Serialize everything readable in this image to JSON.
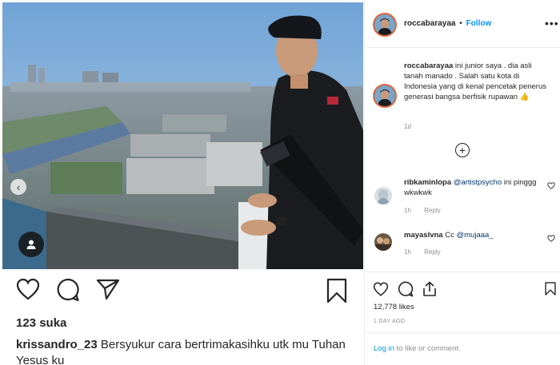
{
  "post": {
    "likes_count_text": "123 suka",
    "caption_user": "krissandro_23",
    "caption_text": "Bersyukur cara bertrimakasihku utk mu Tuhan Yesus ku"
  },
  "panel": {
    "username": "roccabarayaa",
    "separator": "•",
    "follow_label": "Follow",
    "more_label": "•••",
    "owner_caption": {
      "user": "roccabarayaa",
      "text": "ini junior saya . dia asli tanah manado . Salah satu kota di Indonesia yang di kenal pencetak penerus generasi bangsa berfisik rupawan 👍",
      "time": "1d"
    },
    "load_more": "+",
    "comments": [
      {
        "user": "ribkaminlopa",
        "mention": "@artistpsycho",
        "text": "ini pinggg wkwkwk",
        "time": "1h",
        "reply": "Reply"
      },
      {
        "user": "mayaslvna",
        "prefix": "Cc",
        "mention": "@mujaaa_",
        "text": "",
        "time": "1h",
        "reply": "Reply"
      }
    ],
    "likes_text": "12,778 likes",
    "posted_ago": "1 DAY AGO",
    "login_link": "Log in",
    "login_rest": " to like or comment."
  }
}
